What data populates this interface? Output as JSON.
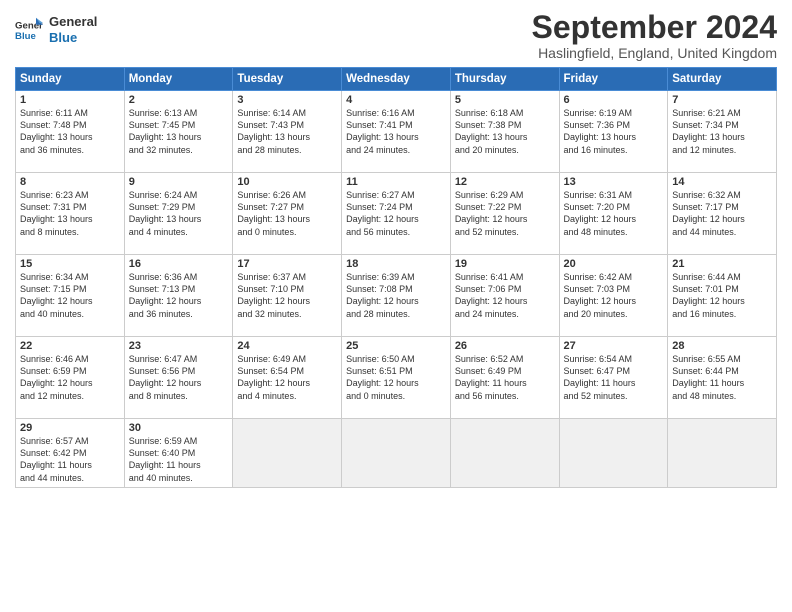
{
  "logo": {
    "line1": "General",
    "line2": "Blue"
  },
  "title": "September 2024",
  "location": "Haslingfield, England, United Kingdom",
  "days_of_week": [
    "Sunday",
    "Monday",
    "Tuesday",
    "Wednesday",
    "Thursday",
    "Friday",
    "Saturday"
  ],
  "weeks": [
    [
      {
        "day": "1",
        "info": "Sunrise: 6:11 AM\nSunset: 7:48 PM\nDaylight: 13 hours\nand 36 minutes."
      },
      {
        "day": "2",
        "info": "Sunrise: 6:13 AM\nSunset: 7:45 PM\nDaylight: 13 hours\nand 32 minutes."
      },
      {
        "day": "3",
        "info": "Sunrise: 6:14 AM\nSunset: 7:43 PM\nDaylight: 13 hours\nand 28 minutes."
      },
      {
        "day": "4",
        "info": "Sunrise: 6:16 AM\nSunset: 7:41 PM\nDaylight: 13 hours\nand 24 minutes."
      },
      {
        "day": "5",
        "info": "Sunrise: 6:18 AM\nSunset: 7:38 PM\nDaylight: 13 hours\nand 20 minutes."
      },
      {
        "day": "6",
        "info": "Sunrise: 6:19 AM\nSunset: 7:36 PM\nDaylight: 13 hours\nand 16 minutes."
      },
      {
        "day": "7",
        "info": "Sunrise: 6:21 AM\nSunset: 7:34 PM\nDaylight: 13 hours\nand 12 minutes."
      }
    ],
    [
      {
        "day": "8",
        "info": "Sunrise: 6:23 AM\nSunset: 7:31 PM\nDaylight: 13 hours\nand 8 minutes."
      },
      {
        "day": "9",
        "info": "Sunrise: 6:24 AM\nSunset: 7:29 PM\nDaylight: 13 hours\nand 4 minutes."
      },
      {
        "day": "10",
        "info": "Sunrise: 6:26 AM\nSunset: 7:27 PM\nDaylight: 13 hours\nand 0 minutes."
      },
      {
        "day": "11",
        "info": "Sunrise: 6:27 AM\nSunset: 7:24 PM\nDaylight: 12 hours\nand 56 minutes."
      },
      {
        "day": "12",
        "info": "Sunrise: 6:29 AM\nSunset: 7:22 PM\nDaylight: 12 hours\nand 52 minutes."
      },
      {
        "day": "13",
        "info": "Sunrise: 6:31 AM\nSunset: 7:20 PM\nDaylight: 12 hours\nand 48 minutes."
      },
      {
        "day": "14",
        "info": "Sunrise: 6:32 AM\nSunset: 7:17 PM\nDaylight: 12 hours\nand 44 minutes."
      }
    ],
    [
      {
        "day": "15",
        "info": "Sunrise: 6:34 AM\nSunset: 7:15 PM\nDaylight: 12 hours\nand 40 minutes."
      },
      {
        "day": "16",
        "info": "Sunrise: 6:36 AM\nSunset: 7:13 PM\nDaylight: 12 hours\nand 36 minutes."
      },
      {
        "day": "17",
        "info": "Sunrise: 6:37 AM\nSunset: 7:10 PM\nDaylight: 12 hours\nand 32 minutes."
      },
      {
        "day": "18",
        "info": "Sunrise: 6:39 AM\nSunset: 7:08 PM\nDaylight: 12 hours\nand 28 minutes."
      },
      {
        "day": "19",
        "info": "Sunrise: 6:41 AM\nSunset: 7:06 PM\nDaylight: 12 hours\nand 24 minutes."
      },
      {
        "day": "20",
        "info": "Sunrise: 6:42 AM\nSunset: 7:03 PM\nDaylight: 12 hours\nand 20 minutes."
      },
      {
        "day": "21",
        "info": "Sunrise: 6:44 AM\nSunset: 7:01 PM\nDaylight: 12 hours\nand 16 minutes."
      }
    ],
    [
      {
        "day": "22",
        "info": "Sunrise: 6:46 AM\nSunset: 6:59 PM\nDaylight: 12 hours\nand 12 minutes."
      },
      {
        "day": "23",
        "info": "Sunrise: 6:47 AM\nSunset: 6:56 PM\nDaylight: 12 hours\nand 8 minutes."
      },
      {
        "day": "24",
        "info": "Sunrise: 6:49 AM\nSunset: 6:54 PM\nDaylight: 12 hours\nand 4 minutes."
      },
      {
        "day": "25",
        "info": "Sunrise: 6:50 AM\nSunset: 6:51 PM\nDaylight: 12 hours\nand 0 minutes."
      },
      {
        "day": "26",
        "info": "Sunrise: 6:52 AM\nSunset: 6:49 PM\nDaylight: 11 hours\nand 56 minutes."
      },
      {
        "day": "27",
        "info": "Sunrise: 6:54 AM\nSunset: 6:47 PM\nDaylight: 11 hours\nand 52 minutes."
      },
      {
        "day": "28",
        "info": "Sunrise: 6:55 AM\nSunset: 6:44 PM\nDaylight: 11 hours\nand 48 minutes."
      }
    ],
    [
      {
        "day": "29",
        "info": "Sunrise: 6:57 AM\nSunset: 6:42 PM\nDaylight: 11 hours\nand 44 minutes."
      },
      {
        "day": "30",
        "info": "Sunrise: 6:59 AM\nSunset: 6:40 PM\nDaylight: 11 hours\nand 40 minutes."
      },
      {
        "day": "",
        "info": ""
      },
      {
        "day": "",
        "info": ""
      },
      {
        "day": "",
        "info": ""
      },
      {
        "day": "",
        "info": ""
      },
      {
        "day": "",
        "info": ""
      }
    ]
  ]
}
